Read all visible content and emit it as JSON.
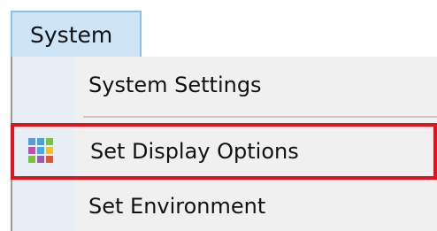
{
  "menubar": {
    "system_label": "System"
  },
  "menu": {
    "items": [
      {
        "label": "System Settings"
      },
      {
        "label": "Set Display Options",
        "icon": "grid-icon",
        "highlighted": true
      },
      {
        "label": "Set Environment"
      }
    ]
  },
  "colors": {
    "menubar_active_bg": "#cde5f7",
    "menubar_active_border": "#8cc1e6",
    "highlight_outline": "#e0141c",
    "menu_bg": "#f0f0f0",
    "icon_grid": [
      "#5b9bd5",
      "#4aa0d8",
      "#7cc242",
      "#c04fa8",
      "#3fa9f5",
      "#f2c02e",
      "#7cc242",
      "#9b59b6",
      "#e2543a"
    ]
  }
}
